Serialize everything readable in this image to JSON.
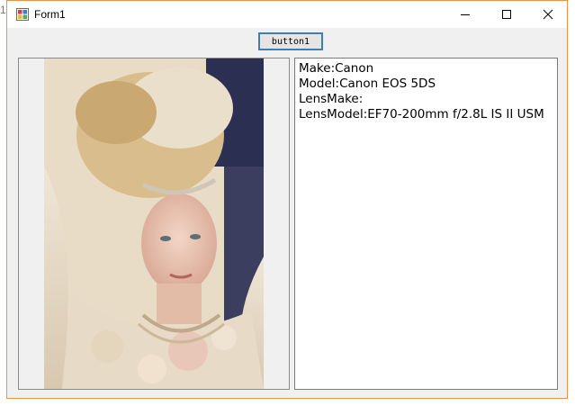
{
  "background": {
    "edge_text": "1"
  },
  "window": {
    "title": "Form1",
    "accent_border": "#e8954a",
    "controls": {
      "minimize_icon": "minimize-icon",
      "maximize_icon": "maximize-icon",
      "close_icon": "close-icon"
    }
  },
  "toolbar": {
    "button1_label": "button1"
  },
  "picture": {
    "icon": "photo-portrait"
  },
  "textbox": {
    "lines": [
      "Make:Canon",
      "Model:Canon EOS 5DS",
      "LensMake:",
      "LensModel:EF70-200mm f/2.8L IS II USM"
    ]
  }
}
